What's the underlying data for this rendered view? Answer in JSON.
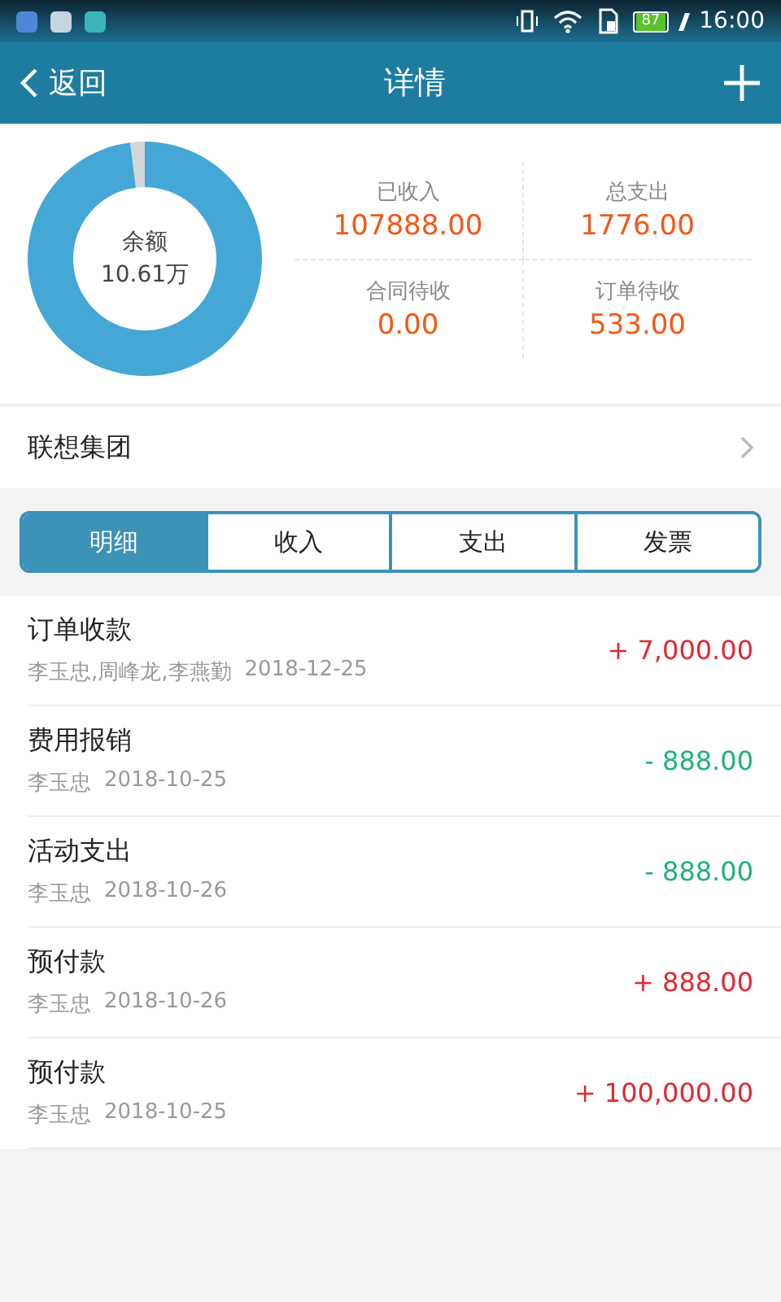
{
  "status_bar": {
    "battery": "87",
    "time": "16:00"
  },
  "header": {
    "back": "返回",
    "title": "详情"
  },
  "summary": {
    "balance_label": "余额",
    "balance": "10.61万",
    "stats": [
      {
        "label": "已收入",
        "value": "107888.00"
      },
      {
        "label": "总支出",
        "value": "1776.00"
      },
      {
        "label": "合同待收",
        "value": "0.00"
      },
      {
        "label": "订单待收",
        "value": "533.00"
      }
    ]
  },
  "company": "联想集团",
  "tabs": [
    {
      "label": "明细",
      "selected": true
    },
    {
      "label": "收入",
      "selected": false
    },
    {
      "label": "支出",
      "selected": false
    },
    {
      "label": "发票",
      "selected": false
    }
  ],
  "transactions": [
    {
      "title": "订单收款",
      "people": "李玉忠,周峰龙,李燕勤",
      "date": "2018-12-25",
      "amount": "+ 7,000.00",
      "kind": "income"
    },
    {
      "title": "费用报销",
      "people": "李玉忠",
      "date": "2018-10-25",
      "amount": "- 888.00",
      "kind": "expense"
    },
    {
      "title": "活动支出",
      "people": "李玉忠",
      "date": "2018-10-26",
      "amount": "- 888.00",
      "kind": "expense"
    },
    {
      "title": "预付款",
      "people": "李玉忠",
      "date": "2018-10-26",
      "amount": "+ 888.00",
      "kind": "income"
    },
    {
      "title": "预付款",
      "people": "李玉忠",
      "date": "2018-10-25",
      "amount": "+ 100,000.00",
      "kind": "income"
    }
  ]
}
